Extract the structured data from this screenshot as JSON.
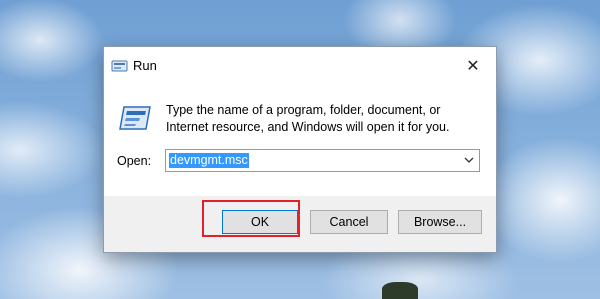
{
  "window": {
    "title": "Run",
    "title_icon": "run-icon",
    "close_icon": "close-icon"
  },
  "dialog": {
    "icon": "run-icon-large",
    "description": "Type the name of a program, folder, document, or Internet resource, and Windows will open it for you.",
    "open_label": "Open:",
    "open_value": "devmgmt.msc"
  },
  "buttons": {
    "ok": "OK",
    "cancel": "Cancel",
    "browse": "Browse..."
  },
  "colors": {
    "highlight": "#e0202a",
    "selection": "#3399ff",
    "focus": "#0078d7"
  }
}
